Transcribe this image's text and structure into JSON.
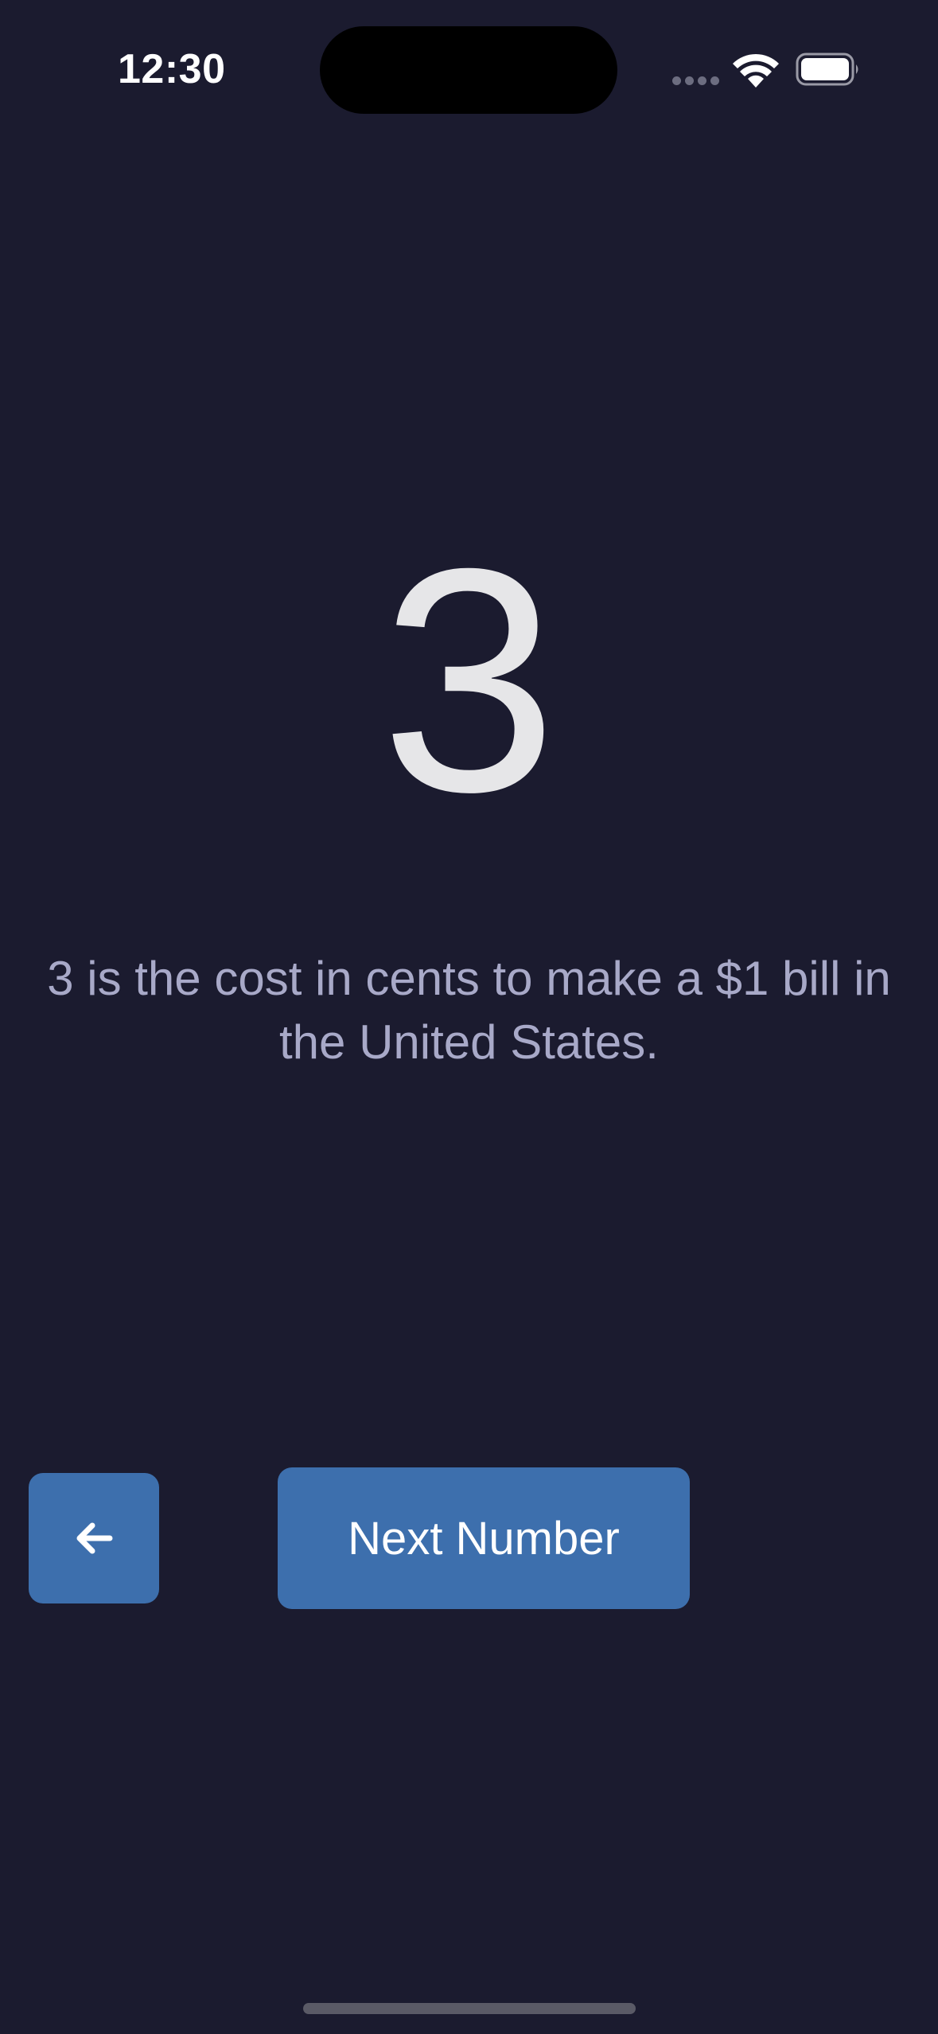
{
  "status_bar": {
    "time": "12:30",
    "icons": [
      "signal-dots-icon",
      "wifi-icon",
      "battery-icon"
    ]
  },
  "main": {
    "number": "3",
    "fact": "3 is the cost in cents to make a $1 bill in the United States."
  },
  "buttons": {
    "back_icon": "arrow-left-icon",
    "next_label": "Next Number"
  },
  "colors": {
    "background": "#1b1b2f",
    "button": "#3d6fad",
    "number_text": "#e6e6e8",
    "fact_text": "#a8a9c8"
  }
}
